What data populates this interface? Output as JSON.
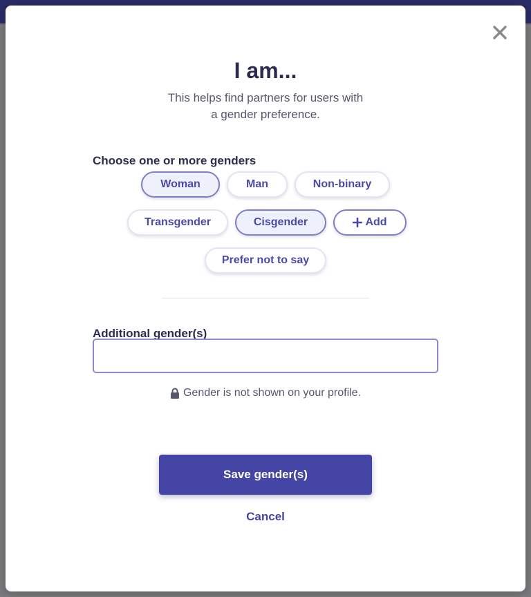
{
  "dialog": {
    "title": "I am...",
    "subtitle_lines": [
      "This helps find partners for users with",
      "a gender preference."
    ],
    "close_icon": "close-icon"
  },
  "genders": {
    "label": "Choose one or more genders",
    "options": [
      {
        "label": "Woman",
        "selected": true
      },
      {
        "label": "Man",
        "selected": false
      },
      {
        "label": "Non-binary",
        "selected": false
      },
      {
        "label": "Transgender",
        "selected": false
      },
      {
        "label": "Cisgender",
        "selected": true
      },
      {
        "label": "Add",
        "selected": false,
        "icon": "plus-icon"
      },
      {
        "label": "Prefer not to say",
        "selected": false
      }
    ]
  },
  "additional": {
    "label": "Additional gender(s)",
    "value": "",
    "placeholder": ""
  },
  "privacy": {
    "text": "Gender is not shown on your profile.",
    "icon": "lock-icon"
  },
  "actions": {
    "save_label": "Save gender(s)",
    "cancel_label": "Cancel"
  },
  "colors": {
    "accent": "#4545a5",
    "chip_selected_bg": "#eef0fb",
    "chip_border_selected": "#7f7fc7",
    "title_text": "#2b2c4f",
    "header_bar": "#2b2c66"
  }
}
